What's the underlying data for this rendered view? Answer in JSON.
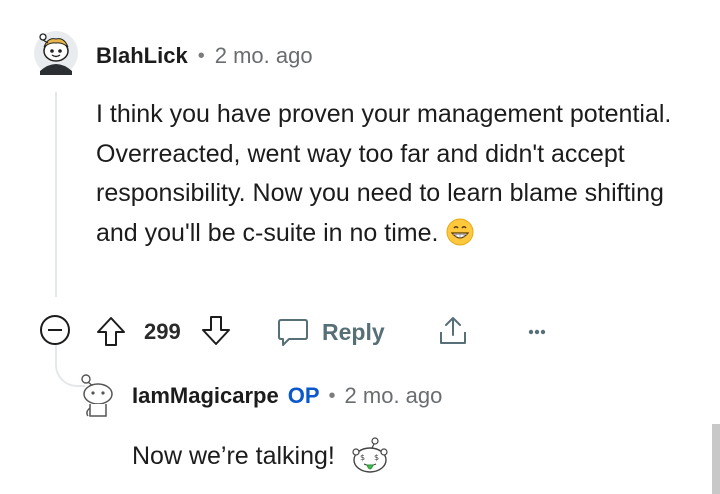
{
  "comment": {
    "username": "BlahLick",
    "separator": "•",
    "time": "2 mo. ago",
    "body": "I think you have proven your management potential. Overreacted, went way too far and didn't accept responsibility. Now you need to learn blame shifting and you'll be c-suite in no time.",
    "emoji_icon": "grinning-face-icon",
    "actions": {
      "collapse_icon": "collapse-minus-icon",
      "upvote_icon": "upvote-arrow-icon",
      "score": "299",
      "downvote_icon": "downvote-arrow-icon",
      "reply_icon": "speech-bubble-icon",
      "reply_label": "Reply",
      "share_icon": "share-icon",
      "more_icon": "more-dots-icon"
    }
  },
  "reply": {
    "username": "IamMagicarpe",
    "badge": "OP",
    "separator": "•",
    "time": "2 mo. ago",
    "body": "Now we’re talking!",
    "emoji_icon": "snoo-money-tongue-icon"
  },
  "colors": {
    "text": "#1c1c1c",
    "meta": "#6a6d70",
    "op_badge": "#0a58ca",
    "thread_line": "#e5e8ea",
    "reply_label": "#576f76"
  }
}
